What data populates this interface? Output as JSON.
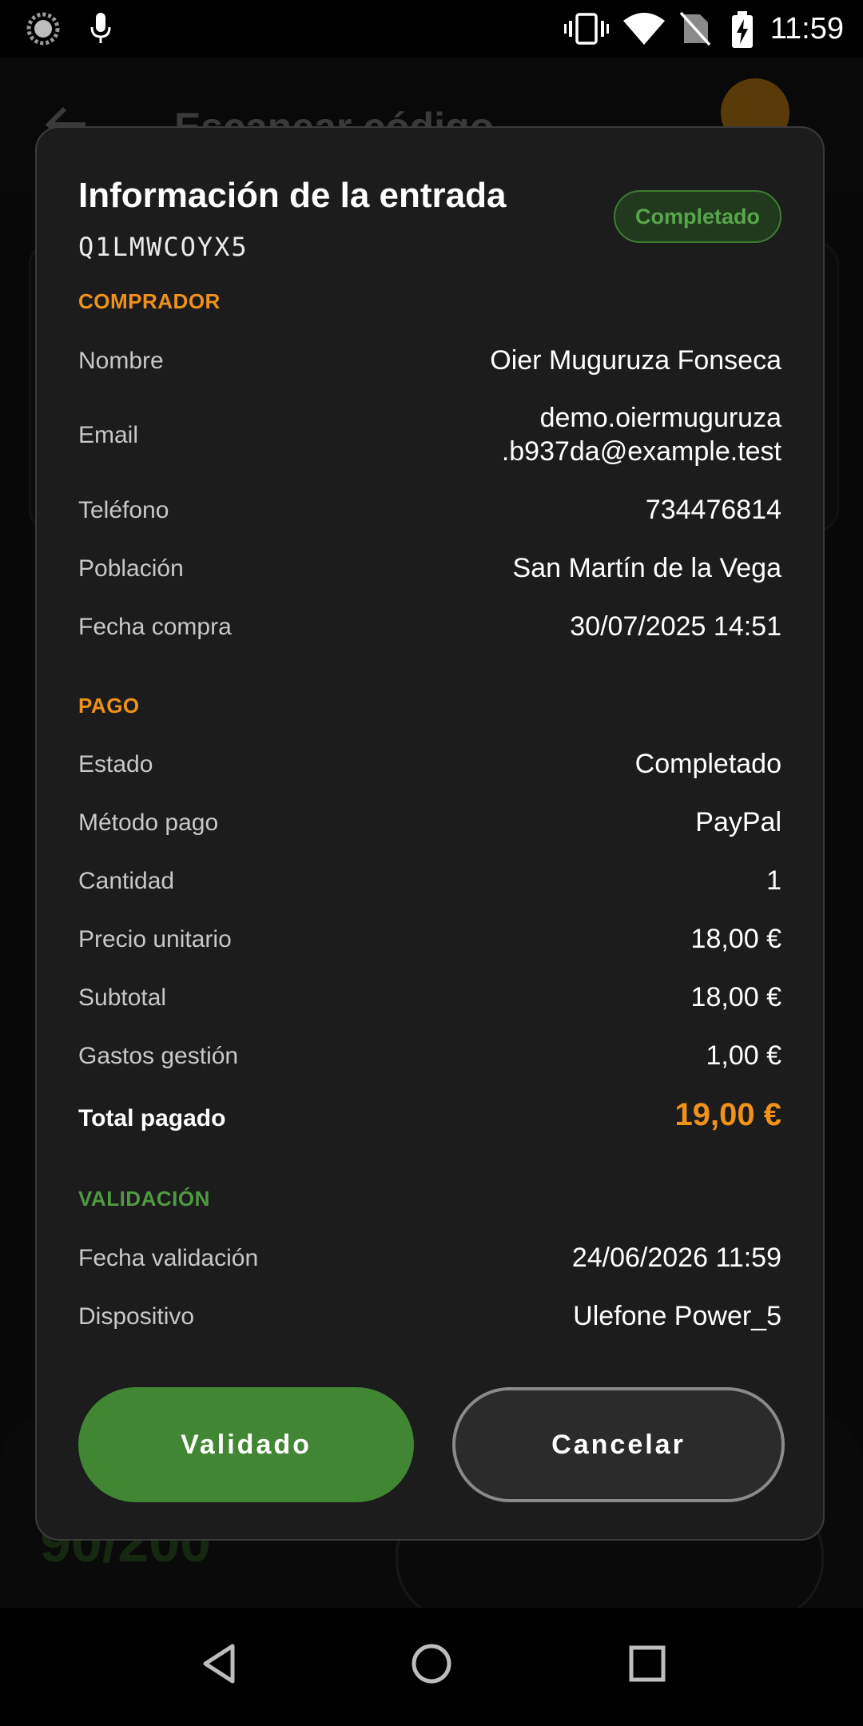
{
  "status_bar": {
    "time": "11:59",
    "icons": [
      "loading-icon",
      "mic-icon",
      "vibrate-icon",
      "wifi-icon",
      "no-sim-icon",
      "battery-charging-icon"
    ]
  },
  "background": {
    "title": "Escanear código",
    "counter": "90/200"
  },
  "dialog": {
    "title": "Información de la entrada",
    "code": "Q1LMWCOYX5",
    "status_badge": "Completado",
    "buyer": {
      "header": "COMPRADOR",
      "rows": [
        {
          "label": "Nombre",
          "value": "Oier Muguruza Fonseca"
        },
        {
          "label": "Email",
          "value": "demo.oiermuguruza\n.b937da@example.test"
        },
        {
          "label": "Teléfono",
          "value": "734476814"
        },
        {
          "label": "Población",
          "value": "San Martín de la Vega"
        },
        {
          "label": "Fecha compra",
          "value": "30/07/2025 14:51"
        }
      ]
    },
    "payment": {
      "header": "PAGO",
      "rows": [
        {
          "label": "Estado",
          "value": "Completado"
        },
        {
          "label": "Método pago",
          "value": "PayPal"
        },
        {
          "label": "Cantidad",
          "value": "1"
        },
        {
          "label": "Precio unitario",
          "value": "18,00 €"
        },
        {
          "label": "Subtotal",
          "value": "18,00 €"
        },
        {
          "label": "Gastos gestión",
          "value": "1,00 €"
        }
      ],
      "total_label": "Total pagado",
      "total_value": "19,00 €"
    },
    "validation": {
      "header": "VALIDACIÓN",
      "rows": [
        {
          "label": "Fecha validación",
          "value": "24/06/2026 11:59"
        },
        {
          "label": "Dispositivo",
          "value": "Ulefone Power_5"
        }
      ]
    },
    "buttons": {
      "validate": "Validado",
      "cancel": "Cancelar"
    }
  },
  "colors": {
    "accent_orange": "#f0921a",
    "accent_green": "#418733",
    "validation_green": "#4f9a40",
    "dialog_bg": "#1c1c1d"
  }
}
